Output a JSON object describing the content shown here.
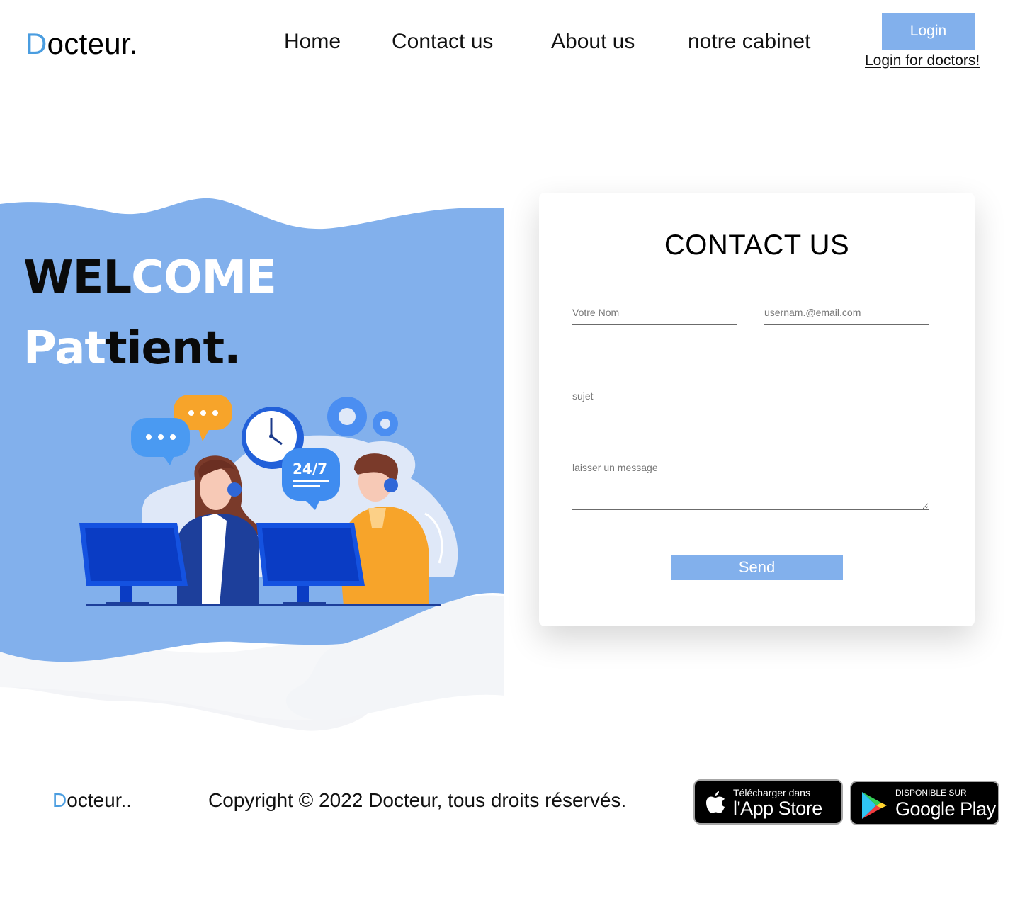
{
  "header": {
    "logo_first": "D",
    "logo_rest": "octeur.",
    "nav": [
      "Home",
      "Contact us",
      "About us",
      "notre cabinet"
    ],
    "login_label": "Login",
    "doctor_login_label": "Login for doctors!"
  },
  "hero": {
    "line1_dark": "WEL",
    "line1_light": "COME",
    "line2_light": "Pat",
    "line2_dark": "tient.",
    "badge_24_7": "24/7"
  },
  "contact": {
    "title": "CONTACT US",
    "name_placeholder": "Votre Nom",
    "email_placeholder": "usernam.@email.com",
    "subject_placeholder": "sujet",
    "message_placeholder": "laisser un message",
    "send_label": "Send"
  },
  "footer": {
    "logo_first": "D",
    "logo_rest": "octeur..",
    "copyright": "Copyright © 2022 Docteur, tous droits réservés.",
    "app_store_small": "Télécharger dans",
    "app_store_big": "l'App Store",
    "google_play_small": "DISPONIBLE SUR",
    "google_play_big": "Google Play"
  },
  "colors": {
    "accent": "#82b0ec",
    "logo_accent": "#4a9de0",
    "hero_background": "#82b0ec"
  }
}
